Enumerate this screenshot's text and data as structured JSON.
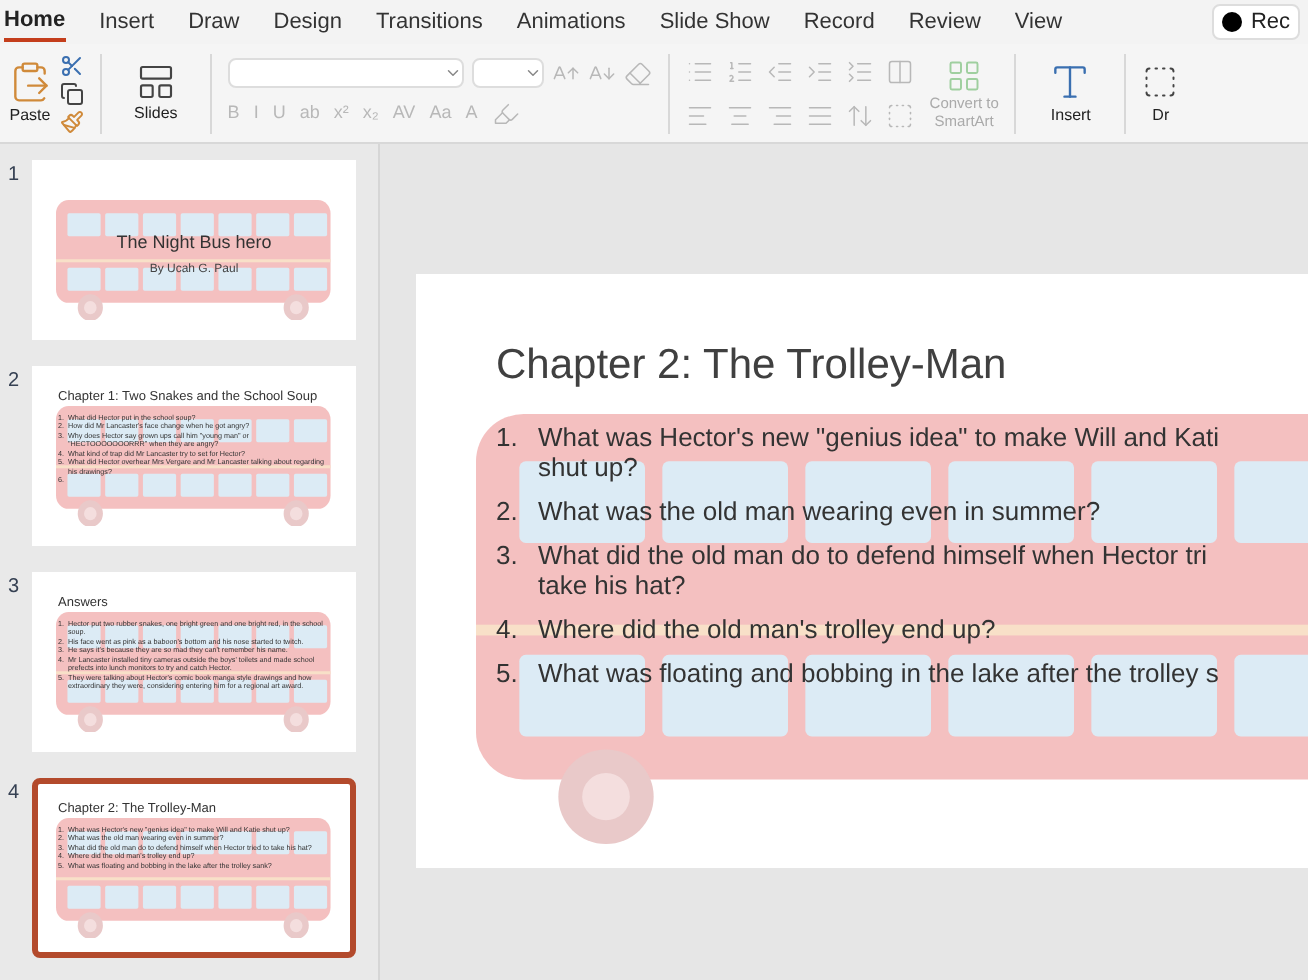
{
  "ribbon_tabs": [
    {
      "label": "Home",
      "selected": true
    },
    {
      "label": "Insert",
      "selected": false
    },
    {
      "label": "Draw",
      "selected": false
    },
    {
      "label": "Design",
      "selected": false
    },
    {
      "label": "Transitions",
      "selected": false
    },
    {
      "label": "Animations",
      "selected": false
    },
    {
      "label": "Slide Show",
      "selected": false
    },
    {
      "label": "Record",
      "selected": false
    },
    {
      "label": "Review",
      "selected": false
    },
    {
      "label": "View",
      "selected": false
    }
  ],
  "record_button": {
    "label": "Rec"
  },
  "ribbon": {
    "paste": "Paste",
    "slides": "Slides",
    "format_disabled": true,
    "format_buttons": [
      "B",
      "I",
      "U",
      "ab",
      "x²",
      "x₂",
      "AV",
      "Aa",
      "A"
    ],
    "convert": "Convert to\nSmartArt",
    "insert": "Insert",
    "draw": "Dr"
  },
  "thumbnails": [
    {
      "number": "1",
      "selected": false,
      "kind": "title",
      "title": "The Night Bus hero",
      "subtitle": "By Ucah G. Paul"
    },
    {
      "number": "2",
      "selected": false,
      "kind": "list",
      "title": "Chapter 1: Two Snakes and the School Soup",
      "items": [
        {
          "number": "1.",
          "text": "What did Hector put in the school soup?"
        },
        {
          "number": "2.",
          "text": "How did Mr Lancaster's face change when he got angry?"
        },
        {
          "number": "3.",
          "text": "Why does Hector say grown ups call him \"young man\" or \"HECTOOOOOOORRR\" when they are angry?"
        },
        {
          "number": "4.",
          "text": "What kind of trap did Mr Lancaster try to set for Hector?"
        },
        {
          "number": "5.",
          "text": "What did Hector overhear Mrs Vergare and Mr Lancaster talking about regarding his drawings?"
        },
        {
          "number": "6."
        }
      ]
    },
    {
      "number": "3",
      "selected": false,
      "kind": "list",
      "title": "Answers",
      "items": [
        {
          "number": "1.",
          "text": "Hector put two rubber snakes, one bright green and one bright red, in the school soup."
        },
        {
          "number": "2.",
          "text": "His face went as pink as a baboon's bottom and his nose started to twitch."
        },
        {
          "number": "3.",
          "text": "He says it's because they are so mad they can't remember his name."
        },
        {
          "number": "4.",
          "text": "Mr Lancaster installed tiny cameras outside the boys' toilets and made school prefects into lunch monitors to try and catch Hector."
        },
        {
          "number": "5.",
          "text": "They were talking about Hector's comic book manga style drawings and how extraordinary they were, considering entering him for a regional art award."
        }
      ]
    },
    {
      "number": "4",
      "selected": true,
      "kind": "list",
      "title": "Chapter 2: The Trolley-Man",
      "items": [
        {
          "number": "1.",
          "text": "What was Hector's new \"genius idea\" to make Will and Katie shut up?"
        },
        {
          "number": "2.",
          "text": "What was the old man wearing even in summer?"
        },
        {
          "number": "3.",
          "text": "What did the old man do to defend himself when Hector tried to take his hat?"
        },
        {
          "number": "4.",
          "text": "Where did the old man's trolley end up?"
        },
        {
          "number": "5.",
          "text": "What was floating and bobbing in the lake after the trolley sank?"
        }
      ]
    }
  ],
  "slide": {
    "title": "Chapter 2: The Trolley-Man",
    "items": [
      {
        "number": "1.",
        "text": "What was Hector's new \"genius idea\" to make Will and Kati\nshut up?"
      },
      {
        "number": "2.",
        "text": "What was the old man wearing even in summer?"
      },
      {
        "number": "3.",
        "text": "What did the old man do to defend himself when Hector tri\ntake his hat?"
      },
      {
        "number": "4.",
        "text": "Where did the old man's trolley end up?"
      },
      {
        "number": "5.",
        "text": "What was floating and bobbing in the lake after the trolley s"
      }
    ]
  }
}
